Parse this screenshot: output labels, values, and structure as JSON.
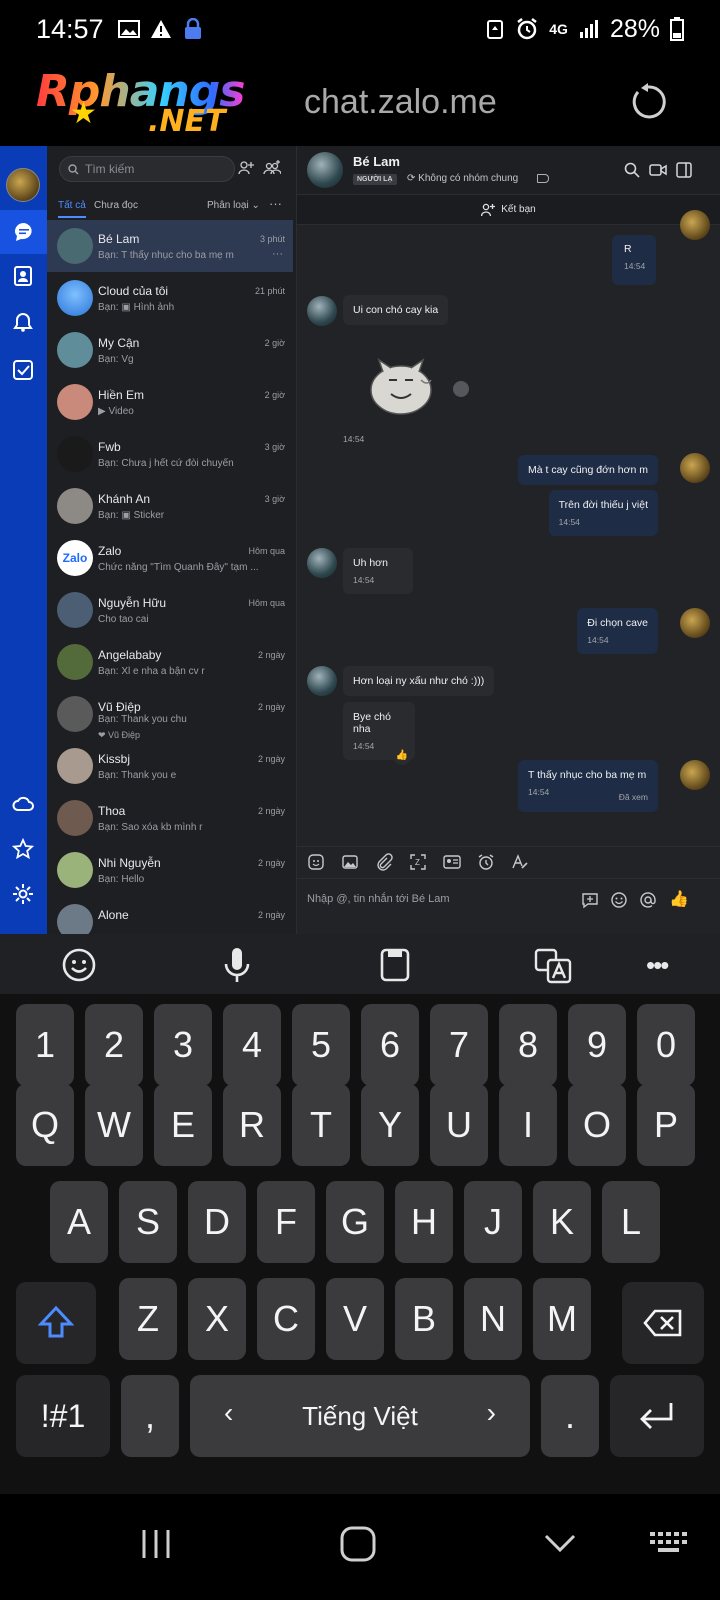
{
  "status": {
    "time": "14:57",
    "network": "4G",
    "battery": "28%"
  },
  "browser": {
    "logo_main": "Rphangs",
    "logo_sub": ".NET",
    "url": "chat.zalo.me"
  },
  "search": {
    "placeholder": "Tìm kiếm"
  },
  "tabs": {
    "all": "Tất cả",
    "unread": "Chưa đọc",
    "classify": "Phân loại",
    "more": "···"
  },
  "conversations": [
    {
      "name": "Bé Lam",
      "preview": "Bạn: T thấy nhục cho ba mẹ m",
      "time": "3 phút",
      "avatar_color": "#4a6a72"
    },
    {
      "name": "Cloud của tôi",
      "preview": "Bạn: ▣ Hình ảnh",
      "time": "21 phút",
      "avatar_color": "#3b8fe0"
    },
    {
      "name": "My Cận",
      "preview": "Bạn: Vg",
      "time": "2 giờ",
      "avatar_color": "#5f8d99"
    },
    {
      "name": "Hiền Em",
      "preview": "▶ Video",
      "time": "2 giờ",
      "avatar_color": "#c98a7b"
    },
    {
      "name": "Fwb",
      "preview": "Bạn: Chưa j hết cứ đòi chuyển",
      "time": "3 giờ",
      "avatar_color": "#1a1a1a"
    },
    {
      "name": "Khánh An",
      "preview": "Bạn: ▣ Sticker",
      "time": "3 giờ",
      "avatar_color": "#8d8a86"
    },
    {
      "name": "Zalo",
      "preview": "Chức năng \"Tìm Quanh Đây\" tạm ...",
      "time": "Hôm qua",
      "avatar_color": "#ffffff"
    },
    {
      "name": "Nguyễn Hữu",
      "preview": "Cho tao cai",
      "time": "Hôm qua",
      "avatar_color": "#4b5e73"
    },
    {
      "name": "Angelababy",
      "preview": "Bạn: Xl e nha a bận cv r",
      "time": "2 ngày",
      "avatar_color": "#536b3b"
    },
    {
      "name": "Vũ Điệp",
      "preview": "Bạn: Thank you chu",
      "sub": "❤ Vũ Điệp",
      "time": "2 ngày",
      "avatar_color": "#5a5a5a"
    },
    {
      "name": "Kissbj",
      "preview": "Bạn: Thank you e",
      "time": "2 ngày",
      "avatar_color": "#a89a8e"
    },
    {
      "name": "Thoa",
      "preview": "Bạn: Sao xóa kb mình r",
      "time": "2 ngày",
      "avatar_color": "#6e5a4e"
    },
    {
      "name": "Nhi Nguyễn",
      "preview": "Bạn: Hello",
      "time": "2 ngày",
      "avatar_color": "#9ab37a"
    },
    {
      "name": "Alone",
      "preview": "",
      "time": "2 ngày",
      "avatar_color": "#6c7a88"
    }
  ],
  "chat": {
    "name": "Bé Lam",
    "tag": "NGƯỜI LẠ",
    "group_info": "Không có nhóm chung",
    "add_friend": "Kết bạn",
    "input_placeholder": "Nhập @, tin nhắn tới Bé Lam",
    "messages": [
      {
        "side": "out",
        "text": "R",
        "time": "14:54"
      },
      {
        "side": "in",
        "text": "Ui con chó cay kia"
      },
      {
        "side": "in",
        "sticker": "cat-sticker",
        "time": "14:54"
      },
      {
        "side": "out",
        "text": "Mà t cay cũng đớn hơn m"
      },
      {
        "side": "out",
        "text": "Trên đời thiếu j việt",
        "time": "14:54"
      },
      {
        "side": "in",
        "text": "Uh hơn",
        "time": "14:54"
      },
      {
        "side": "out",
        "text": "Đi chọn cave",
        "time": "14:54"
      },
      {
        "side": "in",
        "text": "Hơn loại ny xấu như chó :)))"
      },
      {
        "side": "in",
        "text": "Bye chó nha",
        "time": "14:54"
      },
      {
        "side": "out",
        "text": "T thấy nhục cho ba mẹ m",
        "time": "14:54",
        "status": "Đã xem"
      }
    ]
  },
  "keyboard": {
    "row_numbers": [
      "1",
      "2",
      "3",
      "4",
      "5",
      "6",
      "7",
      "8",
      "9",
      "0"
    ],
    "row1": [
      "Q",
      "W",
      "E",
      "R",
      "T",
      "Y",
      "U",
      "I",
      "O",
      "P"
    ],
    "row2": [
      "A",
      "S",
      "D",
      "F",
      "G",
      "H",
      "J",
      "K",
      "L"
    ],
    "row3": [
      "Z",
      "X",
      "C",
      "V",
      "B",
      "N",
      "M"
    ],
    "symbols": "!#1",
    "comma": ",",
    "space": "Tiếng Việt",
    "period": ".",
    "toolbar_more": "•••"
  },
  "colors": {
    "rail": "#0a3cb8",
    "accent": "#4f8cff",
    "bubble_out": "#1e2c45",
    "bubble_in": "#2a2b2f"
  }
}
